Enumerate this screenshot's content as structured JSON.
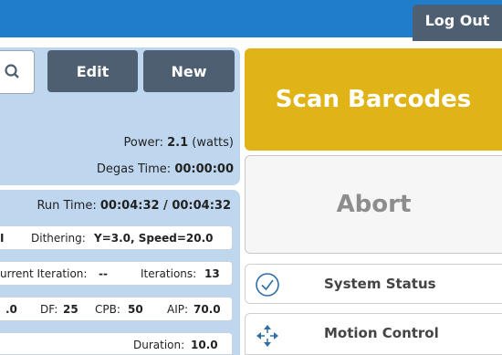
{
  "header": {
    "logout_label": "Log Out"
  },
  "toolbar": {
    "edit_label": "Edit",
    "new_label": "New"
  },
  "info": {
    "power_label": "Power:",
    "power_value": "2.1",
    "power_unit": "(watts)",
    "degas_label": "Degas Time:",
    "degas_value": "00:00:00",
    "runtime_label": "Run Time:",
    "runtime_value": "00:04:32 / 00:04:32"
  },
  "cards": {
    "row1": {
      "lead": "I",
      "dithering_label": "Dithering:",
      "dithering_value": "Y=3.0, Speed=20.0"
    },
    "row2": {
      "current_label": "urrent Iteration:",
      "current_value": "--",
      "iterations_label": "Iterations:",
      "iterations_value": "13"
    },
    "row3": {
      "lead": ".0",
      "df_label": "DF:",
      "df_value": "25",
      "cpb_label": "CPB:",
      "cpb_value": "50",
      "aip_label": "AIP:",
      "aip_value": "70.0"
    },
    "row4": {
      "duration_label": "Duration:",
      "duration_value": "10.0"
    }
  },
  "actions": {
    "scan_label": "Scan Barcodes",
    "abort_label": "Abort"
  },
  "nav": [
    {
      "label": "System Status",
      "icon": "check-circle-icon"
    },
    {
      "label": "Motion Control",
      "icon": "move-arrows-icon"
    }
  ],
  "colors": {
    "topbar": "#1f7dcb",
    "button_dark": "#4d5f70",
    "panel": "#bed7ef",
    "scan": "#e0b416",
    "nav_icon": "#2e6fa7"
  }
}
